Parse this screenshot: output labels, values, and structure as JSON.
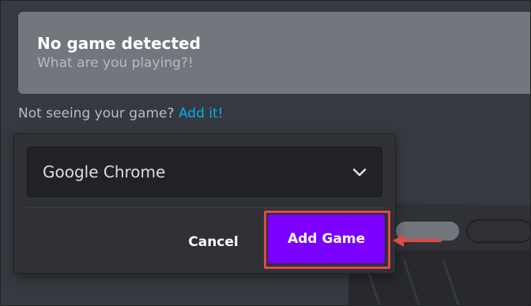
{
  "detected": {
    "title": "No game detected",
    "subtitle": "What are you playing?!"
  },
  "hint": {
    "prefix": "Not seeing your game?",
    "link": "Add it!"
  },
  "popup": {
    "selected_game": "Google Chrome",
    "cancel_label": "Cancel",
    "add_label": "Add Game"
  },
  "colors": {
    "accent_button": "#7b00ff",
    "highlight": "#e04a4a",
    "link": "#00aff4"
  }
}
